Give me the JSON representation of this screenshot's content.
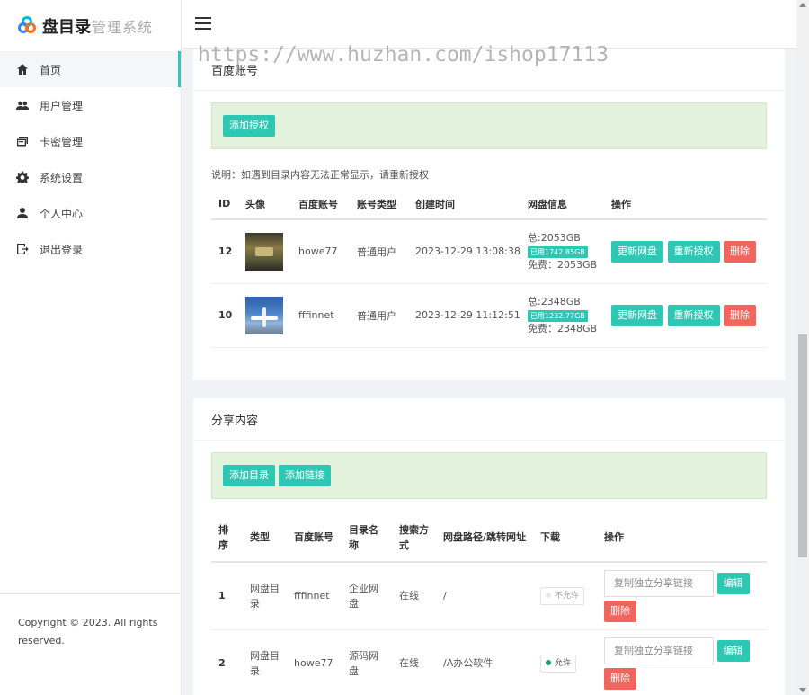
{
  "brand": {
    "name": "盘目录",
    "subtitle": "管理系统"
  },
  "sidebar": {
    "items": [
      {
        "label": "首页",
        "icon": "home-icon",
        "active": true
      },
      {
        "label": "用户管理",
        "icon": "users-icon",
        "active": false
      },
      {
        "label": "卡密管理",
        "icon": "cards-icon",
        "active": false
      },
      {
        "label": "系统设置",
        "icon": "gear-icon",
        "active": false
      },
      {
        "label": "个人中心",
        "icon": "user-icon",
        "active": false
      },
      {
        "label": "退出登录",
        "icon": "logout-icon",
        "active": false
      }
    ],
    "footer": "Copyright © 2023. All rights reserved."
  },
  "header": {
    "menu_icon": "hamburger-icon"
  },
  "watermark": "https://www.huzhan.com/ishop17113",
  "accounts": {
    "title": "百度账号",
    "add_button": "添加授权",
    "note": "说明：如遇到目录内容无法正常显示，请重新授权",
    "columns": [
      "ID",
      "头像",
      "百度账号",
      "账号类型",
      "创建时间",
      "网盘信息",
      "操作"
    ],
    "rows": [
      {
        "id": "12",
        "account": "howe77",
        "type": "普通用户",
        "created": "2023-12-29 13:08:38",
        "total": "总:2053GB",
        "used": "已用1742.85GB",
        "free": "免费：2053GB"
      },
      {
        "id": "10",
        "account": "fffinnet",
        "type": "普通用户",
        "created": "2023-12-29 11:12:51",
        "total": "总:2348GB",
        "used": "已用1232.77GB",
        "free": "免费：2348GB"
      }
    ],
    "btn_refresh": "更新网盘",
    "btn_reauth": "重新授权",
    "btn_delete": "删除"
  },
  "shares": {
    "title": "分享内容",
    "add_dir_button": "添加目录",
    "add_link_button": "添加链接",
    "columns": [
      "排序",
      "类型",
      "百度账号",
      "目录名称",
      "搜索方式",
      "网盘路径/跳转网址",
      "下载",
      "操作"
    ],
    "rows": [
      {
        "order": "1",
        "type": "网盘目录",
        "account": "fffinnet",
        "name": "企业网盘",
        "search": "在线",
        "path": "/",
        "download": "不允许",
        "download_on": false
      },
      {
        "order": "2",
        "type": "网盘目录",
        "account": "howe77",
        "name": "源码网盘",
        "search": "在线",
        "path": "/A办公软件",
        "download": "允许",
        "download_on": true
      }
    ],
    "copy_placeholder": "复制独立分享链接",
    "btn_edit": "编辑",
    "btn_delete": "删除"
  }
}
